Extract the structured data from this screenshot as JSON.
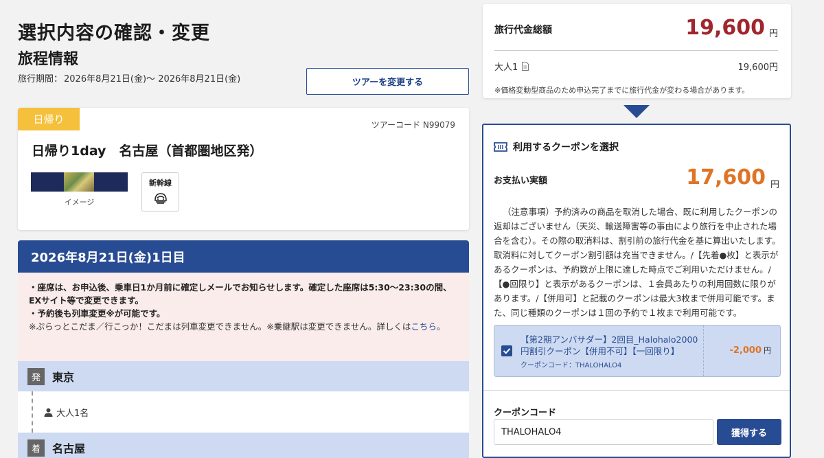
{
  "page": {
    "title": "選択内容の確認・変更",
    "section_title": "旅程情報",
    "period_label": "旅行期間：",
    "period_value": "2026年8月21日(金)〜 2026年8月21日(金)",
    "change_tour_label": "ツアーを変更する"
  },
  "tour": {
    "badge": "日帰り",
    "code": "ツアーコード N99079",
    "name": "日帰り1day　名古屋（首都圏地区発）",
    "image_caption": "イメージ",
    "transport_label": "新幹線",
    "transport_icon": "shinkansen-icon"
  },
  "day": {
    "header": "2026年8月21日(金)1日目",
    "notice_1": "・座席は、お申込後、乗車日1か月前に確定しメールでお知らせします。確定した座席は5:30〜23:30の間、EXサイト等で変更できます。",
    "notice_2": "・予約後も列車変更※が可能です。",
    "notice_3": "※ぷらっとこだま／行こっか！こだまは列車変更できません。※乗継駅は変更できません。詳しくは",
    "notice_link": "こちら",
    "notice_end": "。",
    "depart_badge": "発",
    "depart_station": "東京",
    "passengers": "大人1名",
    "arrive_badge": "着",
    "arrive_station": "名古屋"
  },
  "total": {
    "label": "旅行代金総額",
    "amount": "19,600",
    "yen": "円",
    "adult_label": "大人1",
    "adult_price": "19,600円",
    "note": "※価格変動型商品のため申込完了までに旅行代金が変わる場合があります。"
  },
  "coupon": {
    "title": "利用するクーポンを選択",
    "pay_label": "お支払い実額",
    "pay_amount": "17,600",
    "pay_yen": "円",
    "terms": "（注意事項）予約済みの商品を取消した場合、既に利用したクーポンの返却はございません（天災、輸送障害等の事由により旅行を中止された場合を含む）。その際の取消料は、割引前の旅行代金を基に算出いたします。取消料に対してクーポン割引額は充当できません。/【先着●枚】と表示があるクーポンは、予約数が上限に達した時点でご利用いただけません。/【●回限り】と表示があるクーポンは、１会員あたりの利用回数に限りがあります。/【併用可】と記載のクーポンは最大3枚まで併用可能です。また、同じ種類のクーポンは１回の予約で１枚まで利用可能です。",
    "item_name": "【第2期アンバサダー】2回目_Halohalo2000円割引クーポン【併用不可】【一回限り】",
    "item_code": "クーポンコード：THALOHALO4",
    "item_discount": "-2,000",
    "item_yen": "円",
    "item_checked": true,
    "code_label": "クーポンコード",
    "code_value": "THALOHALO4",
    "acquire_label": "獲得する"
  },
  "colors": {
    "navy": "#284c93",
    "badge_yellow": "#f5c03c",
    "total_red": "#a0262e",
    "pay_orange": "#e07426",
    "station_blue": "#cddaf1",
    "notice_pink": "#f9ecea"
  }
}
